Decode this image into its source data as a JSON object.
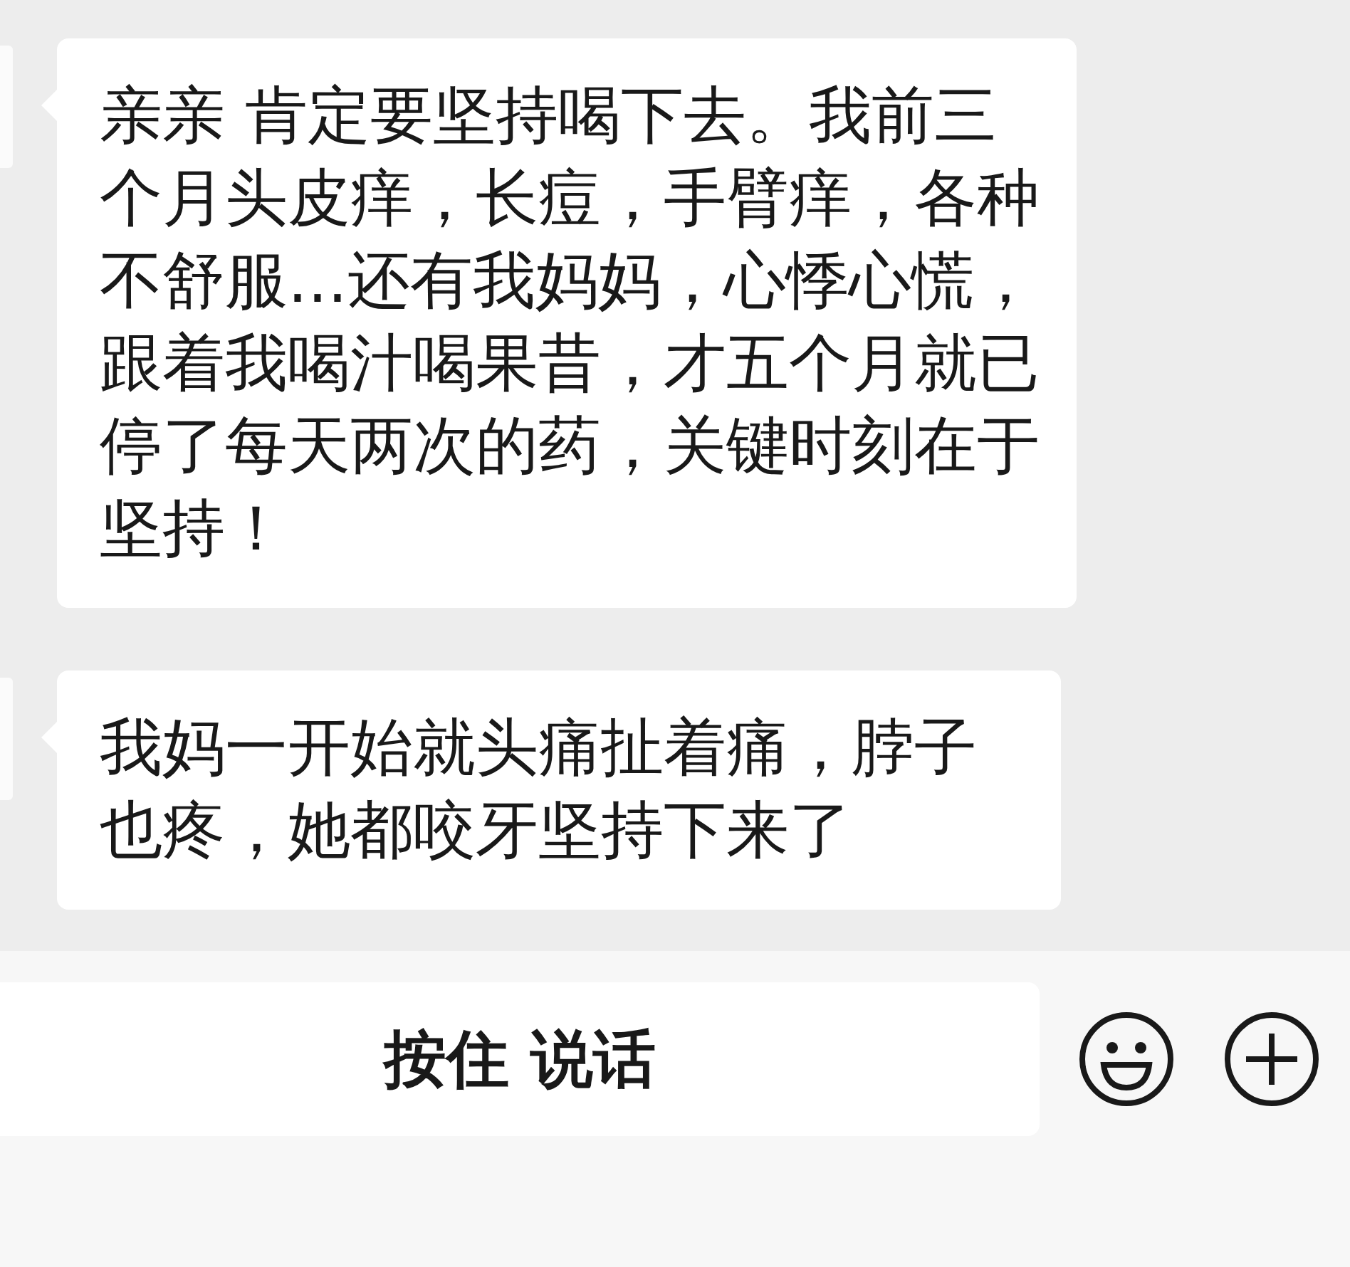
{
  "messages": [
    {
      "text": "亲亲 肯定要坚持喝下去。我前三个月头皮痒，长痘，手臂痒，各种不舒服...还有我妈妈，心悸心慌，跟着我喝汁喝果昔，才五个月就已停了每天两次的药，关键时刻在于坚持！"
    },
    {
      "text": "我妈一开始就头痛扯着痛，脖子也疼，她都咬牙坚持下来了"
    }
  ],
  "input_bar": {
    "hold_to_talk": "按住 说话"
  }
}
